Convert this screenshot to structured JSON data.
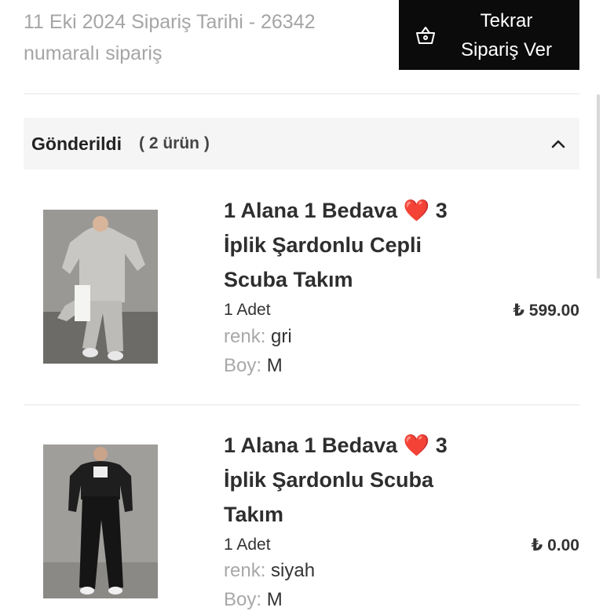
{
  "order": {
    "header_line1": "11 Eki 2024 Sipariş Tarihi - 26342",
    "header_line2": "numaralı sipariş",
    "reorder_line1": "Tekrar",
    "reorder_line2": "Sipariş Ver",
    "reorder_icon": "basket-icon"
  },
  "shipment": {
    "status": "Gönderildi",
    "count": "( 2 ürün )",
    "toggle_icon": "chevron-up-icon"
  },
  "products": [
    {
      "name_line1": "1 Alana 1 Bedava",
      "heart": "❤️",
      "name_line1_tail": "3",
      "name_line2": "İplik Şardonlu Cepli",
      "name_line3": "Scuba Takım",
      "qty": "1 Adet",
      "price": "₺ 599.00",
      "color_label": "renk:",
      "color_value": "gri",
      "size_label": "Boy:",
      "size_value": "M"
    },
    {
      "name_line1": "1 Alana 1 Bedava",
      "heart": "❤️",
      "name_line1_tail": "3",
      "name_line2": "İplik Şardonlu Scuba",
      "name_line3": "Takım",
      "qty": "1 Adet",
      "price": "₺ 0.00",
      "color_label": "renk:",
      "color_value": "siyah",
      "size_label": "Boy:",
      "size_value": "M"
    }
  ],
  "colors": {
    "button_bg": "#0b0b0b",
    "status_bg": "#f5f5f5",
    "heart": "#e02030",
    "muted_text": "#a5a5a5"
  }
}
